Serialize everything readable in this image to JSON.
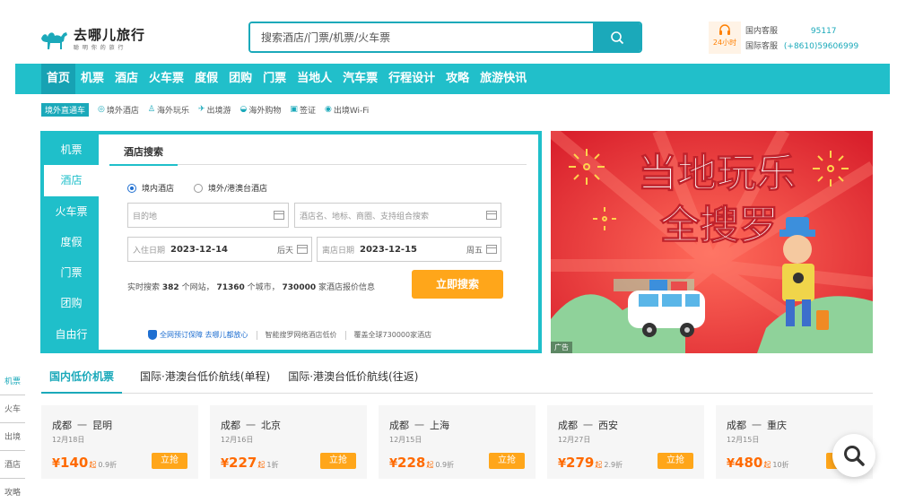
{
  "header": {
    "logo_title": "去哪儿旅行",
    "logo_sub": "聪 明 你 的 旅 行",
    "search_placeholder": "搜索酒店/门票/机票/火车票",
    "service": {
      "badge_hours": "24小时",
      "domestic_label": "国内客服",
      "domestic_number": "95117",
      "intl_label": "国际客服",
      "intl_number": "(+8610)59606999"
    }
  },
  "nav": [
    "首页",
    "机票",
    "酒店",
    "火车票",
    "度假",
    "团购",
    "门票",
    "当地人",
    "汽车票",
    "行程设计",
    "攻略",
    "旅游快讯"
  ],
  "subnav": {
    "tag": "境外直通车",
    "items": [
      "境外酒店",
      "海外玩乐",
      "出境游",
      "海外购物",
      "签证",
      "出境Wi-Fi"
    ]
  },
  "panel": {
    "tabs": [
      "机票",
      "酒店",
      "火车票",
      "度假",
      "门票",
      "团购",
      "自由行"
    ],
    "active_tab": 1,
    "section_title": "酒店搜索",
    "radio_domestic": "境内酒店",
    "radio_intl": "境外/港澳台酒店",
    "destination_placeholder": "目的地",
    "keyword_placeholder": "酒店名、地标、商圈、支持组合搜索",
    "checkin_label": "入住日期",
    "checkin_value": "2023-12-14",
    "checkin_week": "后天",
    "checkout_label": "离店日期",
    "checkout_value": "2023-12-15",
    "checkout_week": "周五",
    "stat_prefix": "实时搜索",
    "stat_sites": "382",
    "stat_sites_unit": "个网站，",
    "stat_cities": "71360",
    "stat_cities_unit": "个城市，",
    "stat_prices": "730000",
    "stat_prices_unit": "家酒店报价信息",
    "search_button": "立即搜索",
    "foot_guarantee": "全网预订保障 去哪儿都放心",
    "foot_lowprice": "智能搜罗网络酒店低价",
    "foot_coverage": "覆盖全球730000家酒店"
  },
  "banner": {
    "line1": "当地玩乐",
    "line2": "全搜罗",
    "ad_tag": "广告"
  },
  "lowprice": {
    "tabs": [
      "国内低价机票",
      "国际·港澳台低价航线(单程)",
      "国际·港澳台低价航线(往返)"
    ],
    "arrow": "一",
    "currency": "¥",
    "qi": "起",
    "buy_label": "立抢",
    "cards": [
      {
        "from": "成都",
        "to": "昆明",
        "date": "12月18日",
        "price": "140",
        "discount": "0.9折"
      },
      {
        "from": "成都",
        "to": "北京",
        "date": "12月16日",
        "price": "227",
        "discount": "1折"
      },
      {
        "from": "成都",
        "to": "上海",
        "date": "12月15日",
        "price": "228",
        "discount": "0.9折"
      },
      {
        "from": "成都",
        "to": "西安",
        "date": "12月27日",
        "price": "279",
        "discount": "2.9折"
      },
      {
        "from": "成都",
        "to": "重庆",
        "date": "12月15日",
        "price": "480",
        "discount": "10折"
      }
    ]
  },
  "left_strip": [
    "机票",
    "火车",
    "出境",
    "酒店",
    "攻略"
  ],
  "colors": {
    "brand": "#1ba9ba",
    "nav": "#21bfca",
    "orange": "#ffa61a",
    "price": "#ff6a00",
    "banner": "#e8363c"
  }
}
